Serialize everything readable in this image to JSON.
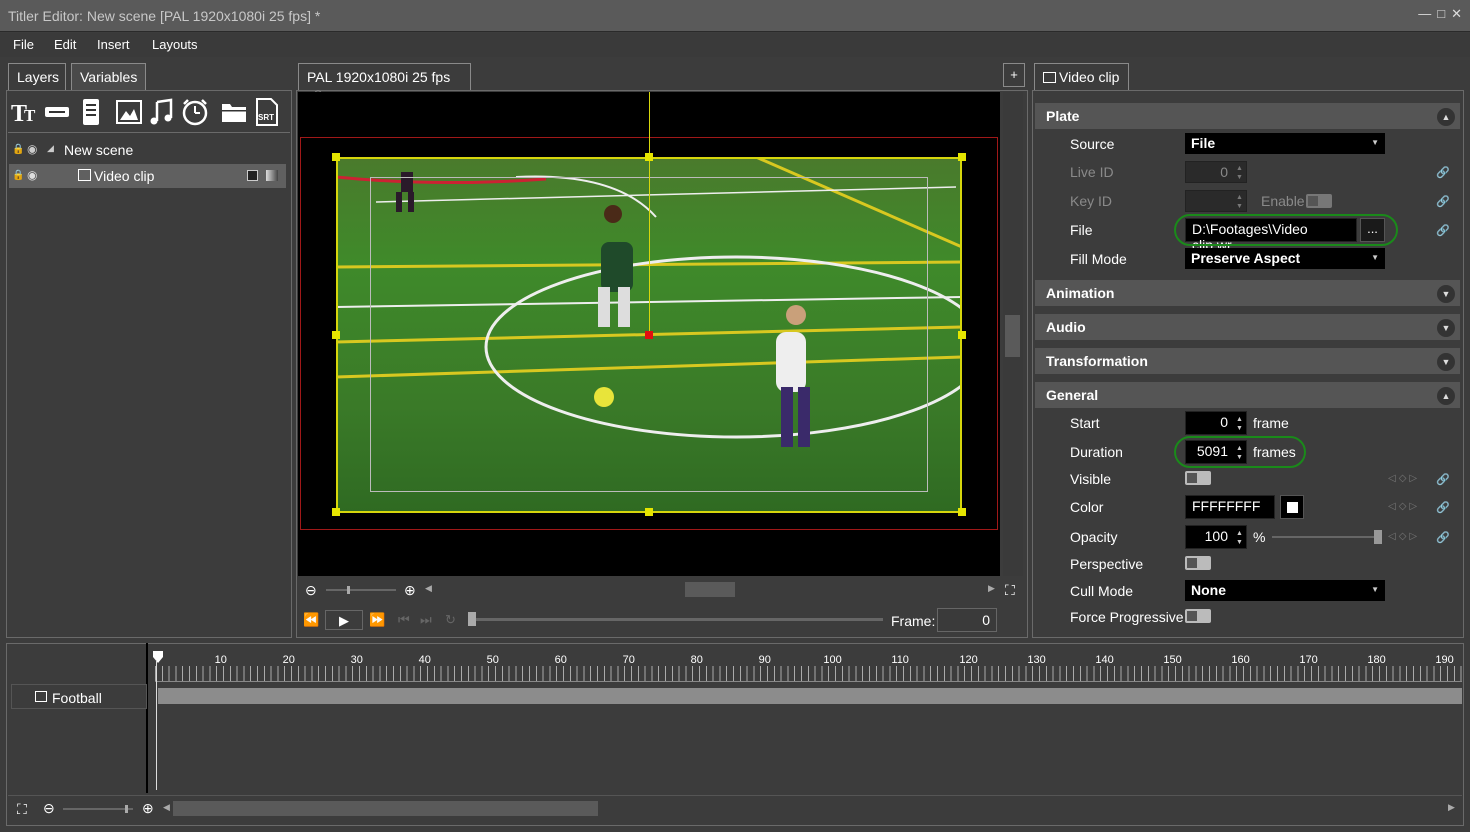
{
  "window": {
    "title": "Titler Editor: New scene [PAL 1920x1080i 25 fps] *"
  },
  "menu": [
    "File",
    "Edit",
    "Insert",
    "Layouts"
  ],
  "left_panel": {
    "tabs": [
      "Layers",
      "Variables"
    ],
    "layers": [
      {
        "label": "New scene"
      },
      {
        "label": "Video clip"
      }
    ]
  },
  "preview": {
    "tab_label": "PAL 1920x1080i 25 fps",
    "add_tab": "+",
    "frame_label": "Frame:",
    "frame_value": "0"
  },
  "properties": {
    "tab_label": "Video clip",
    "sections": {
      "plate": "Plate",
      "animation": "Animation",
      "audio": "Audio",
      "transformation": "Transformation",
      "general": "General"
    },
    "source_label": "Source",
    "source_value": "File",
    "liveid_label": "Live ID",
    "liveid_value": "0",
    "keyid_label": "Key ID",
    "enable_label": "Enable",
    "file_label": "File",
    "file_value": "D:\\Footages\\Video clip.wr",
    "browse": "...",
    "fillmode_label": "Fill Mode",
    "fillmode_value": "Preserve Aspect",
    "start_label": "Start",
    "start_value": "0",
    "start_unit": "frame",
    "duration_label": "Duration",
    "duration_value": "5091",
    "duration_unit": "frames",
    "visible_label": "Visible",
    "color_label": "Color",
    "color_value": "FFFFFFFF",
    "opacity_label": "Opacity",
    "opacity_value": "100",
    "opacity_unit": "%",
    "perspective_label": "Perspective",
    "cullmode_label": "Cull Mode",
    "cullmode_value": "None",
    "forceprog_label": "Force Progressive"
  },
  "timeline": {
    "track_label": "Football",
    "ruler": [
      "10",
      "20",
      "30",
      "40",
      "50",
      "60",
      "70",
      "80",
      "90",
      "100",
      "110",
      "120",
      "130",
      "140",
      "150",
      "160",
      "170",
      "180",
      "190"
    ]
  }
}
